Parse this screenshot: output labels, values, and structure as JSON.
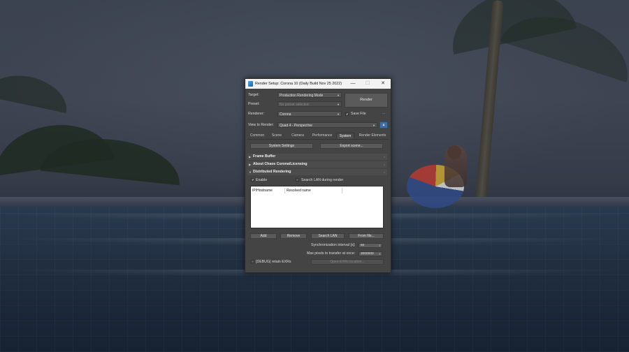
{
  "window": {
    "title": "Render Setup: Corona 10 (Daily Build Nov 25 2022)",
    "minimize_glyph": "—",
    "maximize_glyph": "☐",
    "close_glyph": "✕"
  },
  "header": {
    "target_label": "Target:",
    "target_value": "Production Rendering Mode",
    "preset_label": "Preset:",
    "preset_value": "No preset selected",
    "renderer_label": "Renderer:",
    "renderer_value": "Corona",
    "render_button": "Render",
    "save_file_label": "Save File",
    "save_file_checked": true,
    "more_button": "...",
    "view_label": "View to Render:",
    "view_value": "Quad 4 - Perspective"
  },
  "tabs": [
    {
      "label": "Common",
      "active": false
    },
    {
      "label": "Scene",
      "active": false
    },
    {
      "label": "Camera",
      "active": false
    },
    {
      "label": "Performance",
      "active": false
    },
    {
      "label": "System",
      "active": true
    },
    {
      "label": "Render Elements",
      "active": false
    }
  ],
  "system": {
    "system_settings_button": "System Settings",
    "export_scene_button": "Export scene..."
  },
  "rollouts": {
    "frame_buffer": "Frame Buffer",
    "about": "About Chaos Corona/Licensing",
    "distributed": "Distributed Rendering"
  },
  "distributed": {
    "enable_label": "Enable",
    "enable_checked": true,
    "search_lan_label": "Search LAN during render",
    "search_lan_checked": false,
    "columns": [
      "IP/Hostname",
      "Resolved name"
    ],
    "add_button": "Add",
    "remove_button": "Remove",
    "search_lan_button": "Search LAN",
    "from_file_button": "From file...",
    "sync_label": "Synchronization interval [s]:",
    "sync_value": "60",
    "max_pixels_label": "Max pixels to transfer at once:",
    "max_pixels_value": "3000000",
    "debug_label": "[DEBUG] retain EXRs",
    "debug_checked": false,
    "open_exr_button": "Open EXRs location..."
  }
}
